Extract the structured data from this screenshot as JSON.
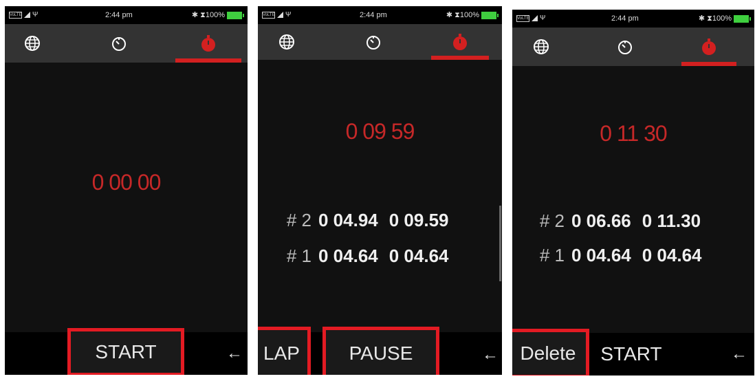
{
  "status": {
    "chip_label": "VoLTE",
    "usb_symbol": "Ψ",
    "clock": "2:44 pm",
    "battery_text": "✱ ⧗100%",
    "battery_color": "#3fcf3f"
  },
  "tabs": [
    {
      "icon": "globe-icon"
    },
    {
      "icon": "timer-icon"
    },
    {
      "icon": "stopwatch-icon",
      "active": true
    }
  ],
  "colors": {
    "accent": "#d32020",
    "time": "#c62828",
    "highlight": "#e31b23"
  },
  "screens": [
    {
      "main_time": "0 00 00",
      "laps": [],
      "buttons": {
        "start": "START"
      },
      "back": "←"
    },
    {
      "main_time": "0 09 59",
      "laps": [
        {
          "index": "# 2",
          "split": "0 04.94",
          "total": "0 09.59"
        },
        {
          "index": "# 1",
          "split": "0 04.64",
          "total": "0 04.64"
        }
      ],
      "buttons": {
        "lap": "LAP",
        "pause": "PAUSE"
      },
      "back": "←"
    },
    {
      "main_time": "0 11 30",
      "laps": [
        {
          "index": "# 2",
          "split": "0 06.66",
          "total": "0 11.30"
        },
        {
          "index": "# 1",
          "split": "0 04.64",
          "total": "0 04.64"
        }
      ],
      "buttons": {
        "delete": "Delete",
        "start": "START"
      },
      "back": "←"
    }
  ]
}
